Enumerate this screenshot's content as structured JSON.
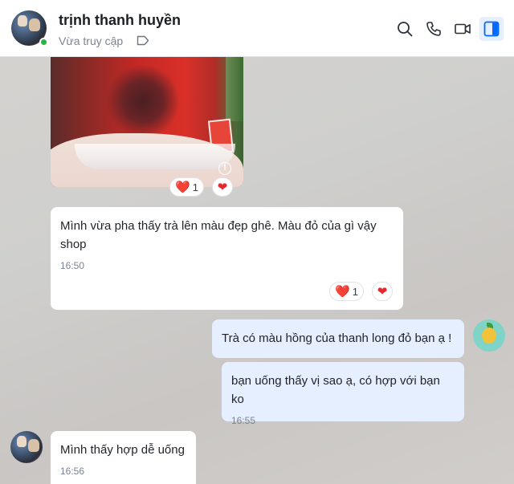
{
  "header": {
    "contact_name": "trịnh thanh huyền",
    "status": "Vừa truy cập",
    "icons": [
      "search-icon",
      "phone-icon",
      "video-call-icon",
      "sidebar-panel-icon",
      "tag-icon"
    ],
    "accent_color": "#0068ff"
  },
  "messages": [
    {
      "type": "image",
      "reactions": {
        "emoji": "❤️",
        "count": "1"
      }
    },
    {
      "type": "text",
      "direction": "incoming",
      "text": "Mình vừa pha thấy trà lên màu đẹp ghê. Màu đỏ của gì vậy shop",
      "time": "16:50",
      "reactions": {
        "emoji": "❤️",
        "count": "1"
      }
    },
    {
      "type": "text",
      "direction": "outgoing",
      "text": "Trà có màu hồng của thanh long đỏ bạn ạ !"
    },
    {
      "type": "text",
      "direction": "outgoing",
      "text": "bạn uống thấy vị sao ạ, có hợp với bạn ko",
      "time": "16:55"
    },
    {
      "type": "text",
      "direction": "incoming",
      "text": "Mình thấy hợp dễ uống",
      "time": "16:56"
    }
  ],
  "colors": {
    "incoming_bubble": "#ffffff",
    "outgoing_bubble": "#e5efff",
    "heart": "#e8262d",
    "online": "#2bb04a"
  }
}
